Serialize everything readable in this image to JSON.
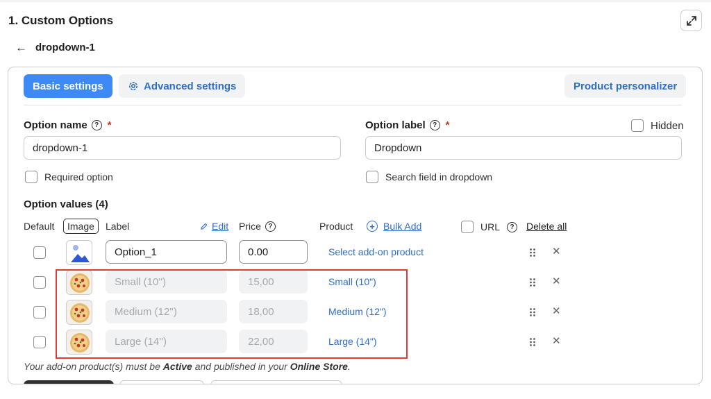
{
  "header": {
    "section_title": "1. Custom Options",
    "back_label": "dropdown-1"
  },
  "tabs": {
    "basic": "Basic settings",
    "advanced": "Advanced settings",
    "personalizer": "Product personalizer"
  },
  "fields": {
    "option_name_label": "Option name",
    "option_name_value": "dropdown-1",
    "option_label_label": "Option label",
    "option_label_value": "Dropdown",
    "required_marker": "*",
    "hidden_label": "Hidden",
    "required_option": "Required option",
    "search_field": "Search field in dropdown"
  },
  "values_table": {
    "title": "Option values (4)",
    "headers": {
      "default": "Default",
      "image": "Image",
      "label": "Label",
      "edit": "Edit",
      "price": "Price",
      "product": "Product",
      "bulk_add": "Bulk Add",
      "url": "URL",
      "delete_all": "Delete all"
    },
    "rows": [
      {
        "label": "Option_1",
        "price": "0.00",
        "product": "Select add-on product"
      },
      {
        "label": "Small (10'')",
        "price": "15,00",
        "product": "Small (10\")"
      },
      {
        "label": "Medium (12'')",
        "price": "18,00",
        "product": "Medium (12\")"
      },
      {
        "label": "Large (14'')",
        "price": "22,00",
        "product": "Large (14\")"
      }
    ],
    "close_glyph": "✕"
  },
  "note": {
    "part1": "Your add-on product(s) must be ",
    "active": "Active",
    "part2": " and published in your ",
    "store": "Online Store",
    "part3": "."
  },
  "colors": {
    "primary": "#3d8af7",
    "link": "#2c6ecb",
    "highlight": "#e53935",
    "bottom_dark": "#303030"
  }
}
